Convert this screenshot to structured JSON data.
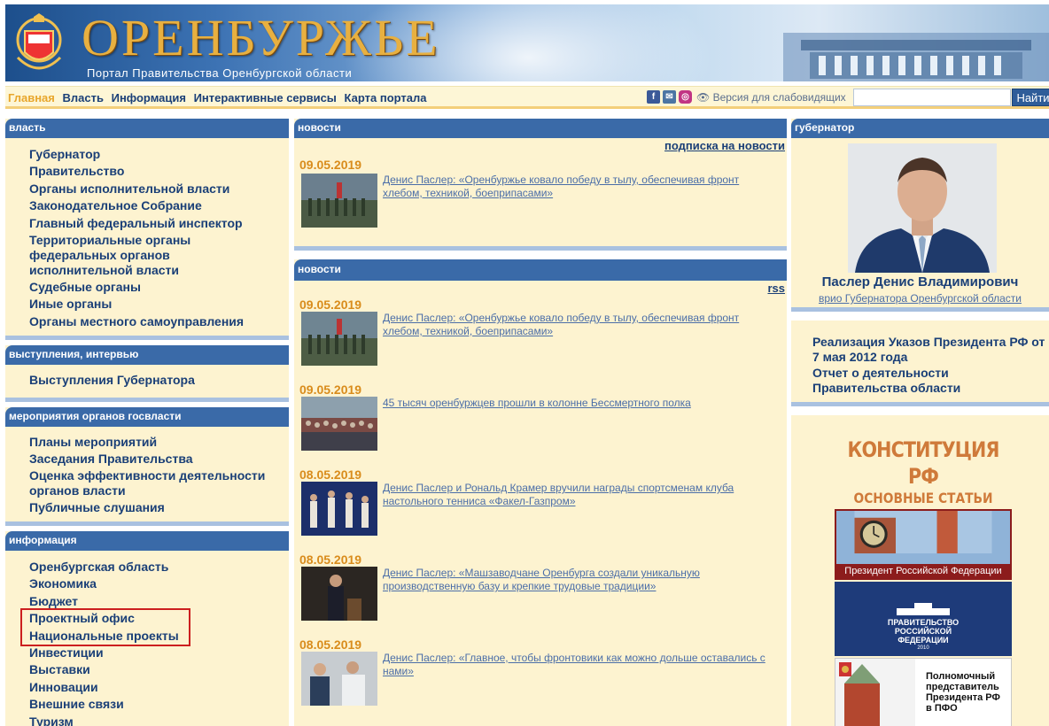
{
  "header": {
    "title": "ОРЕНБУРЖЬЕ",
    "subtitle": "Портал Правительства Оренбургской области"
  },
  "nav": {
    "items": [
      "Главная",
      "Власть",
      "Информация",
      "Интерактивные сервисы",
      "Карта портала"
    ],
    "social": [
      "f",
      "vk",
      "ig"
    ],
    "vision_label": "Версия для слабовидящих",
    "search_placeholder": "",
    "search_button": "Найти"
  },
  "left": {
    "vlast": {
      "title": "власть",
      "items": [
        "Губернатор",
        "Правительство",
        "Органы исполнительной власти",
        "Законодательное Собрание",
        "Главный федеральный инспектор",
        "Территориальные органы федеральных органов исполнительной власти",
        "Судебные органы",
        "Иные органы",
        "Органы местного самоуправления"
      ]
    },
    "speeches": {
      "title": "выступления, интервью",
      "items": [
        "Выступления Губернатора"
      ]
    },
    "events": {
      "title": "мероприятия органов госвласти",
      "items": [
        "Планы мероприятий",
        "Заседания Правительства",
        "Оценка эффективности деятельности органов власти",
        "Публичные слушания"
      ]
    },
    "info": {
      "title": "информация",
      "items": [
        "Оренбургская область",
        "Экономика",
        "Бюджет",
        "Проектный офис",
        "Национальные проекты",
        "Инвестиции",
        "Выставки",
        "Инновации",
        "Внешние связи",
        "Туризм"
      ]
    }
  },
  "mid": {
    "news_top": {
      "title": "новости",
      "subscribe": "подписка на новости",
      "items": [
        {
          "date": "09.05.2019",
          "text": "Денис Паслер: «Оренбуржье ковало победу в тылу, обеспечивая фронт хлебом, техникой, боеприпасами»"
        }
      ]
    },
    "news_main": {
      "title": "новости",
      "rss": "rss",
      "items": [
        {
          "date": "09.05.2019",
          "text": "Денис Паслер: «Оренбуржье ковало победу в тылу, обеспечивая фронт хлебом, техникой, боеприпасами»"
        },
        {
          "date": "09.05.2019",
          "text": "45 тысяч оренбуржцев прошли в колонне Бессмертного полка"
        },
        {
          "date": "08.05.2019",
          "text": "Денис Паслер и Рональд Крамер вручили награды спортсменам клуба настольного тенниса «Факел-Газпром»"
        },
        {
          "date": "08.05.2019",
          "text": "Денис Паслер: «Машзаводчане Оренбурга создали уникальную производственную базу и крепкие трудовые традиции»"
        },
        {
          "date": "08.05.2019",
          "text": "Денис Паслер: «Главное, чтобы фронтовики как можно дольше оставались с нами»"
        }
      ]
    }
  },
  "right": {
    "governor": {
      "title": "губернатор",
      "name": "Паслер Денис Владимирович",
      "post": "врио Губернатора Оренбургской области"
    },
    "links": [
      "Реализация Указов Президента РФ от 7 мая 2012 года",
      "Отчет о деятельности Правительства области"
    ],
    "constitution": {
      "line1": "КОНСТИТУЦИЯ РФ",
      "line2": "ОСНОВНЫЕ СТАТЬИ"
    },
    "president_banner": "Президент Российской Федерации",
    "gov_banner": {
      "line1": "ПРАВИТЕЛЬСТВО",
      "line2": "РОССИЙСКОЙ",
      "line3": "ФЕДЕРАЦИИ",
      "year": "2010"
    },
    "envoy_banner": [
      "Полномочный",
      "представитель",
      "Президента РФ",
      "в ПФО"
    ]
  },
  "colors": {
    "accent_blue": "#3a6aa8",
    "panel_bg": "#fdf3d0",
    "date_orange": "#d98c1c",
    "highlight_red": "#cc1f1f"
  }
}
